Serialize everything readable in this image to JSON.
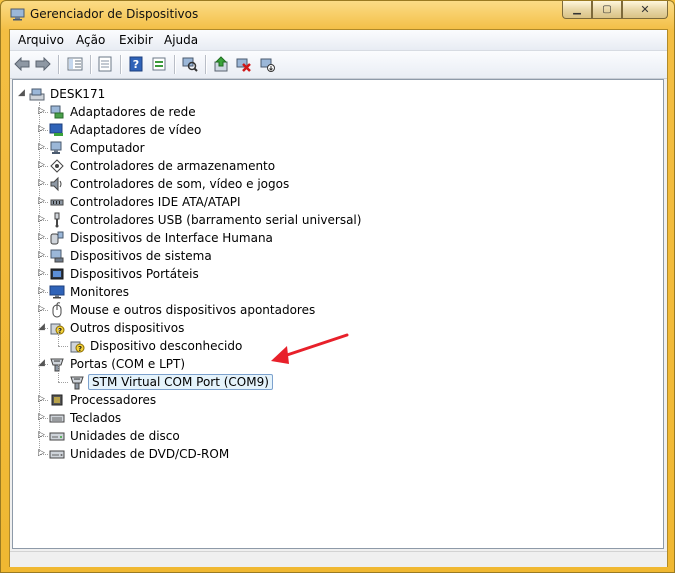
{
  "window": {
    "title": "Gerenciador de Dispositivos"
  },
  "menu": {
    "items": [
      "Arquivo",
      "Ação",
      "Exibir",
      "Ajuda"
    ]
  },
  "toolbar": {
    "buttons": [
      "back-icon",
      "forward-icon",
      "view-icon",
      "properties-icon",
      "help-icon",
      "show-hidden-icon",
      "scan-hardware-icon",
      "update-driver-icon",
      "uninstall-icon",
      "disable-icon"
    ]
  },
  "tree": {
    "root": "DESK171",
    "categories": [
      {
        "label": "Adaptadores de rede",
        "icon": "network-adapter-icon"
      },
      {
        "label": "Adaptadores de vídeo",
        "icon": "display-adapter-icon"
      },
      {
        "label": "Computador",
        "icon": "computer-icon"
      },
      {
        "label": "Controladores de armazenamento",
        "icon": "storage-controller-icon"
      },
      {
        "label": "Controladores de som, vídeo e jogos",
        "icon": "sound-icon"
      },
      {
        "label": "Controladores IDE ATA/ATAPI",
        "icon": "ide-controller-icon"
      },
      {
        "label": "Controladores USB (barramento serial universal)",
        "icon": "usb-icon"
      },
      {
        "label": "Dispositivos de Interface Humana",
        "icon": "hid-icon"
      },
      {
        "label": "Dispositivos de sistema",
        "icon": "system-device-icon"
      },
      {
        "label": "Dispositivos Portáteis",
        "icon": "portable-device-icon"
      },
      {
        "label": "Monitores",
        "icon": "monitor-icon"
      },
      {
        "label": "Mouse e outros dispositivos apontadores",
        "icon": "mouse-icon"
      },
      {
        "label": "Outros dispositivos",
        "icon": "unknown-device-icon",
        "expanded": true,
        "children": [
          {
            "label": "Dispositivo desconhecido",
            "icon": "unknown-device-icon"
          }
        ]
      },
      {
        "label": "Portas (COM e LPT)",
        "icon": "port-icon",
        "expanded": true,
        "children": [
          {
            "label": "STM Virtual COM Port (COM9)",
            "icon": "port-icon",
            "selected": true
          }
        ]
      },
      {
        "label": "Processadores",
        "icon": "processor-icon"
      },
      {
        "label": "Teclados",
        "icon": "keyboard-icon"
      },
      {
        "label": "Unidades de disco",
        "icon": "disk-drive-icon"
      },
      {
        "label": "Unidades de DVD/CD-ROM",
        "icon": "dvd-drive-icon"
      }
    ]
  },
  "annotation": {
    "arrow_color": "#e8202a"
  },
  "colors": {
    "frame": "#f6c240",
    "selection_bg": "#e5f3fb",
    "selection_border": "#7da2ce"
  }
}
